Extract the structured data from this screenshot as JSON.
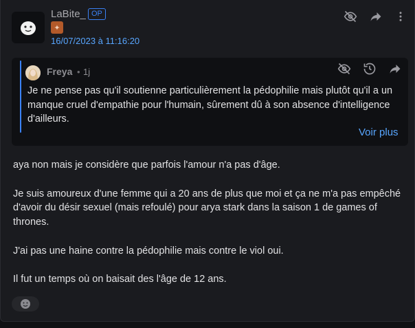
{
  "post": {
    "author": "LaBite_",
    "op_label": "OP",
    "timestamp": "16/07/2023 à 11:16:20",
    "avatar_icon": "smiley-face-icon",
    "rank_icon": "rank-badge-icon",
    "actions": [
      "hide-icon",
      "share-icon",
      "more-vertical-icon"
    ]
  },
  "quote": {
    "author": "Freya",
    "separator": "•",
    "time": "1j",
    "text": "Je ne pense pas qu'il soutienne particulièrement la pédophilie mais plutôt qu'il a un manque cruel d'empathie pour l'humain, sûrement dû à son absence d'intelligence d'ailleurs.",
    "see_more": "Voir plus",
    "actions": [
      "hide-icon",
      "history-icon",
      "share-icon"
    ]
  },
  "body": {
    "paragraphs": [
      "aya non mais je considère que parfois l'amour n'a pas d'âge.",
      "Je suis amoureux d'une femme qui a 20 ans de plus que moi et ça ne m'a pas empêché d'avoir du désir sexuel (mais refoulé) pour arya stark dans la saison 1 de games of thrones.",
      "J'ai pas une haine contre la pédophilie mais contre le viol oui.",
      "Il fut un temps où on baisait des l'âge de 12 ans."
    ]
  },
  "reaction": {
    "icon": "add-reaction-icon"
  },
  "colors": {
    "accent": "#3b82f6",
    "link": "#58a6ff",
    "background": "#1a1b1f",
    "quote_background": "#0f1013"
  }
}
